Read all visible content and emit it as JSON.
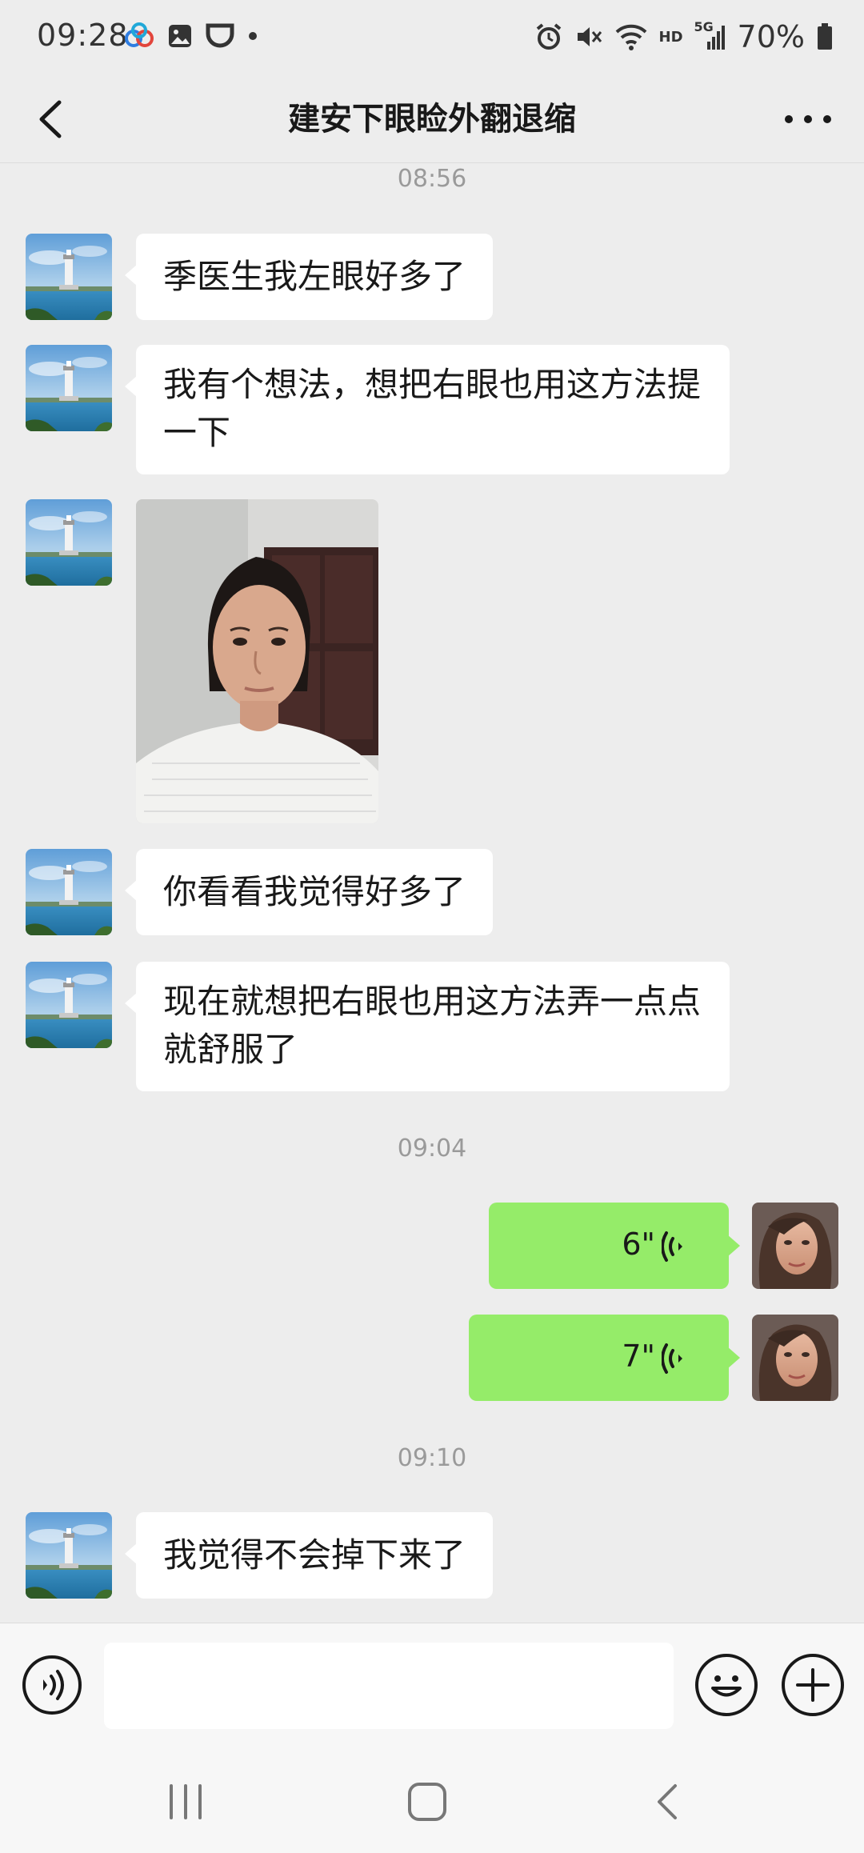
{
  "status_bar": {
    "time": "09:28",
    "battery": "70%",
    "network": "5G",
    "hd": "HD"
  },
  "header": {
    "title": "建安下眼睑外翻退缩"
  },
  "messages": {
    "ts1": "08:56",
    "m1": "季医生我左眼好多了",
    "m2": "我有个想法，想把右眼也用这方法提一下",
    "m3_type": "photo",
    "m4": "你看看我觉得好多了",
    "m5": "现在就想把右眼也用这方法弄一点点就舒服了",
    "ts2": "09:04",
    "v1": "6\"",
    "v2": "7\"",
    "ts3": "09:10",
    "m6": "我觉得不会掉下来了"
  },
  "input": {
    "placeholder": ""
  },
  "colors": {
    "accent_green": "#95ec69",
    "background": "#ededed"
  },
  "icons": [
    "back-icon",
    "more-icon",
    "voice-icon",
    "emoji-icon",
    "plus-icon"
  ]
}
